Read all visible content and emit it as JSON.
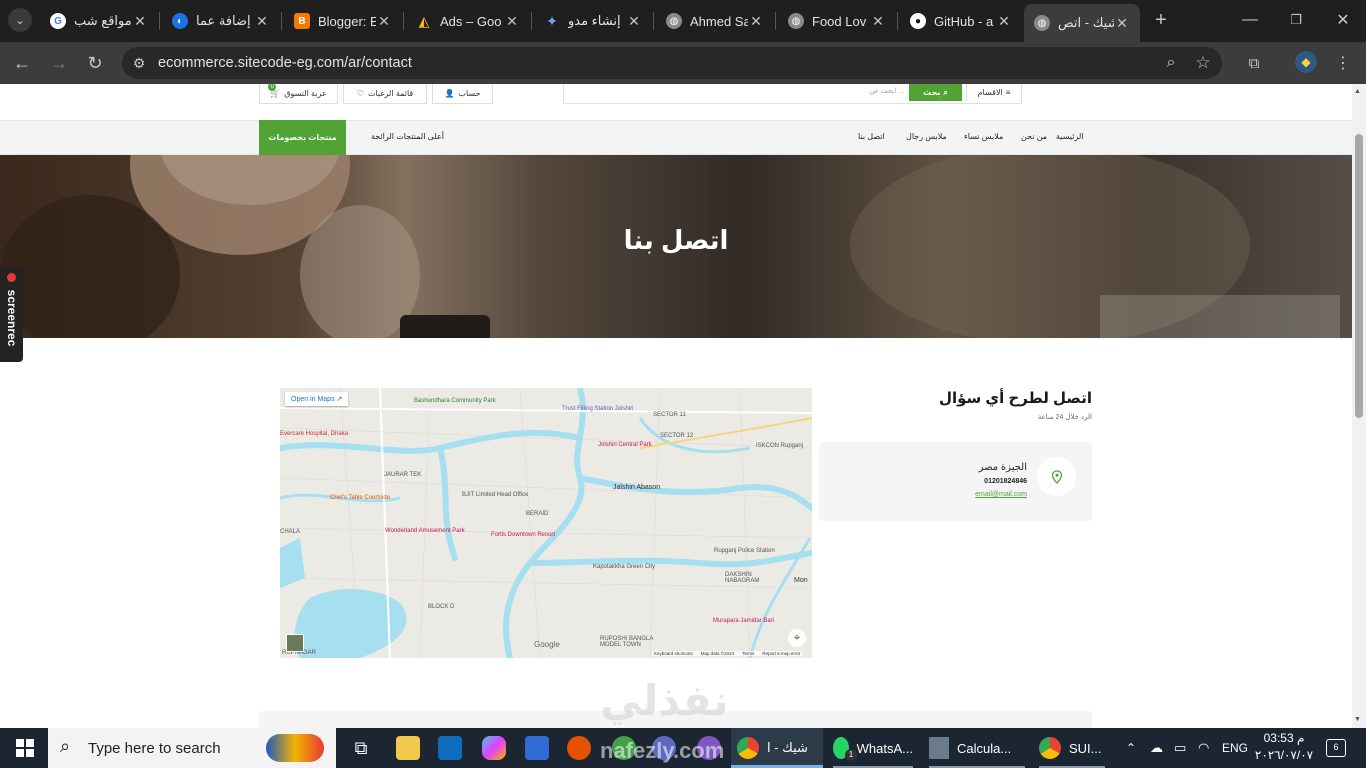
{
  "browser": {
    "tabs": [
      {
        "label": "مواقع شب",
        "icon": "google-icon",
        "color": "#ffffff"
      },
      {
        "label": "إضافة عما",
        "icon": "edge-like-icon",
        "color": "#1a73e8"
      },
      {
        "label": "Blogger: E",
        "icon": "blogger-icon",
        "color": "#f57c00"
      },
      {
        "label": "Ads – Goo",
        "icon": "google-ads-icon",
        "color": "#fbbc04"
      },
      {
        "label": "إنشاء مدو",
        "icon": "gemini-icon",
        "color": "#4285f4"
      },
      {
        "label": "Ahmed Sa",
        "icon": "globe-icon",
        "color": "#8a8a8a"
      },
      {
        "label": "Food Lov",
        "icon": "globe-icon",
        "color": "#8a8a8a"
      },
      {
        "label": "GitHub - a",
        "icon": "github-icon",
        "color": "#ffffff"
      },
      {
        "label": "شيك - اتص",
        "icon": "globe-icon",
        "color": "#8a8a8a"
      }
    ],
    "url": "ecommerce.sitecode-eg.com/ar/contact"
  },
  "header": {
    "cart": "عربة التسوق",
    "wishlist": "قائمة الرغبات",
    "account": "حساب",
    "search_placeholder": "ابحث عن ...",
    "search_button": "بحث",
    "categories": "الاقسام",
    "cart_count": "0"
  },
  "nav": {
    "items": [
      "الرئيسية",
      "من نحن",
      "ملابس نساء",
      "ملابس رجال",
      "اتصل بنا"
    ],
    "best": "أعلى المنتجات الرائجة",
    "deals": "منتجات بخصومات"
  },
  "hero": {
    "title": "اتصل بنا"
  },
  "contact": {
    "heading": "اتصل لطرح أي سؤال",
    "subheading": "الرد خلال 24 ساعة",
    "address": "الجيزة مصر",
    "phone": "01201824846",
    "email": "email@mail.com"
  },
  "map": {
    "open_in_maps": "Open in Maps",
    "labels": [
      "Bashundhara Community Park",
      "Trust Filling Station Jolshiri",
      "SECTOR 11",
      "SECTOR 12",
      "Jolshiri Central Park",
      "ISKCON Rupganj",
      "Evercare Hospital, Dhaka",
      "JAURAR TEK",
      "BJIT Limited Head Office",
      "Jalshiri Abason",
      "Chef's Table Courtside",
      "BERAID",
      "CHALA",
      "Wonderland Amusement Park",
      "Fortis Downtown Resort",
      "Rupganj Police Station",
      "Kapotakkha Green City",
      "DAKSHIN NABAGRAM",
      "BLOCK D",
      "Murapara Jamidar Bari",
      "RUPOSHI BANGLA MODEL TOWN",
      "RUPNAGAR",
      "Mon"
    ],
    "footer": [
      "Keyboard shortcuts",
      "Map data ©2024",
      "Terms",
      "Report a map error"
    ],
    "google": "Google"
  },
  "watermark": "نفذلي",
  "watermark_url": "nafezly.com",
  "screencast": "screenrec",
  "taskbar": {
    "search_placeholder": "Type here to search",
    "apps": [
      "شيك - ا",
      "WhatsA...",
      "Calcula...",
      "SUI..."
    ],
    "whatsapp_badge": "1",
    "lang": "ENG",
    "time": "03:53 م",
    "date": "٢٠٢٦/٠٧/٠٧",
    "notif_count": "6"
  }
}
